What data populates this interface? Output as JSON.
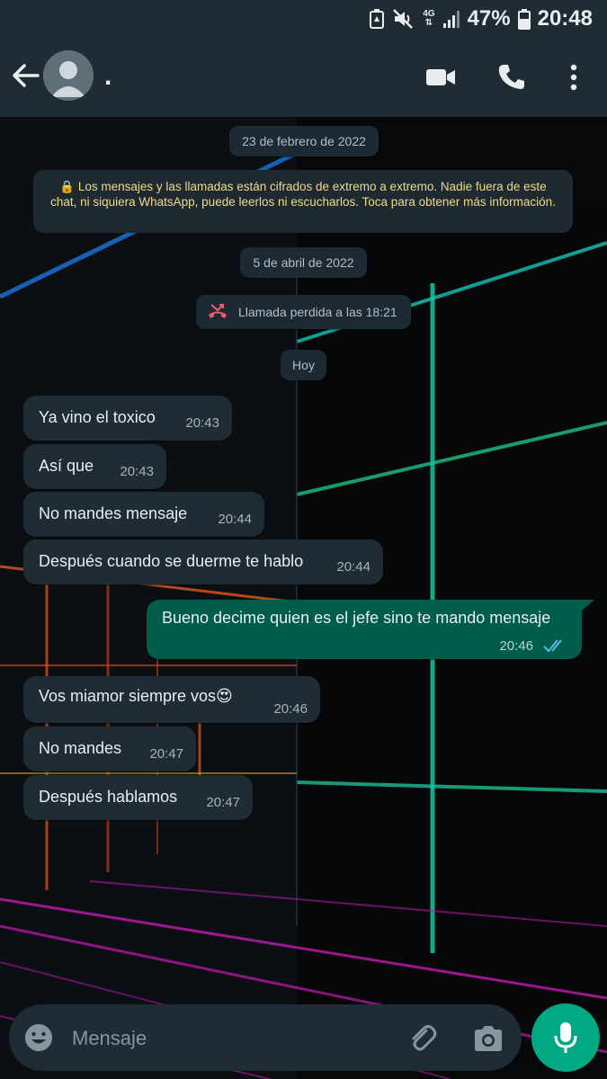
{
  "status_bar": {
    "network": "4G",
    "battery": "47%",
    "time": "20:48"
  },
  "header": {
    "contact_name": ".",
    "icons": [
      "back-arrow-icon",
      "avatar-icon",
      "video-call-icon",
      "phone-call-icon",
      "more-options-icon"
    ]
  },
  "colors": {
    "header_bg": "#1f2c34",
    "incoming_bubble": "#1f2c34",
    "outgoing_bubble": "#005c4b",
    "notice_text": "#f1d98c",
    "accent": "#00a884",
    "read_ticks": "#53bdeb",
    "missed_call": "#f15c6d"
  },
  "chat": {
    "date_1": "23 de febrero de 2022",
    "encryption_notice": "🔒 Los mensajes y las llamadas están cifrados de extremo a extremo. Nadie fuera de este chat, ni siquiera WhatsApp, puede leerlos ni escucharlos. Toca para obtener más información.",
    "date_2": "5 de abril de 2022",
    "missed_call": "Llamada perdida a las 18:21",
    "date_3": "Hoy",
    "messages": [
      {
        "direction": "in",
        "text": "Ya vino el toxico",
        "time": "20:43"
      },
      {
        "direction": "in",
        "text": "Así que",
        "time": "20:43"
      },
      {
        "direction": "in",
        "text": "No mandes mensaje",
        "time": "20:44"
      },
      {
        "direction": "in",
        "text": "Después cuando se duerme te hablo",
        "time": "20:44"
      },
      {
        "direction": "out",
        "text": "Bueno decime quien es el jefe sino te mando mensaje",
        "time": "20:46",
        "status": "read"
      },
      {
        "direction": "in",
        "text": "Vos miamor siempre vos😍",
        "time": "20:46"
      },
      {
        "direction": "in",
        "text": "No mandes",
        "time": "20:47"
      },
      {
        "direction": "in",
        "text": "Después hablamos",
        "time": "20:47"
      }
    ]
  },
  "composer": {
    "placeholder": "Mensaje"
  }
}
